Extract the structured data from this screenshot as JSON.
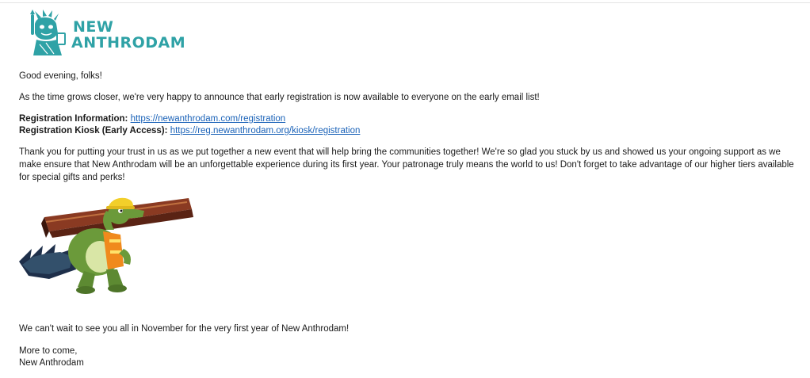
{
  "logo": {
    "line1": "NEW",
    "line2": "ANTHRODAM"
  },
  "email": {
    "greeting": "Good evening, folks!",
    "announcement": "As the time grows closer, we're very happy to announce that early registration is now available to everyone on the early email list!",
    "registration_info_label": "Registration Information:",
    "registration_info_link": "https://newanthrodam.com/registration",
    "kiosk_label": "Registration Kiosk (Early Access):",
    "kiosk_link": "https://reg.newanthrodam.org/kiosk/registration",
    "thanks": "Thank you for putting your trust in us as we put together a new event that will help bring the communities together! We're so glad you stuck by us and showed us your ongoing support as we make ensure that New Anthrodam will be an unforgettable experience during its first year. Your patronage truly means the world to us! Don't forget to take advantage of our higher tiers available for special gifts and perks!",
    "closing_line": "We can't wait to see you all in November for the very first year of New Anthrodam!",
    "signoff": "More to come,",
    "signature": "New Anthrodam"
  },
  "colors": {
    "brand_teal": "#2fa2a6",
    "link_blue": "#1a62b8"
  }
}
